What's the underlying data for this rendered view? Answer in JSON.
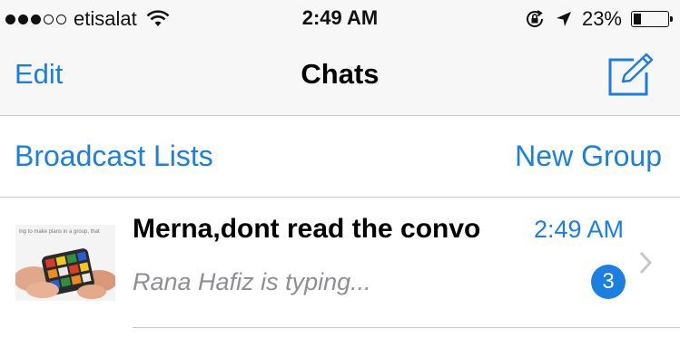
{
  "status_bar": {
    "signal_strength": "3 of 5",
    "carrier": "etisalat",
    "time": "2:49 AM",
    "battery_percent": "23%"
  },
  "nav": {
    "edit_label": "Edit",
    "title": "Chats",
    "compose_icon": "compose-icon"
  },
  "actions": {
    "broadcast_label": "Broadcast Lists",
    "new_group_label": "New Group"
  },
  "chats": [
    {
      "name": "Merna,dont read the convo",
      "time": "2:49 AM",
      "preview": "Rana Hafiz is typing...",
      "unread_count": "3",
      "avatar_caption": "ing to make plans in a group, that"
    }
  ],
  "colors": {
    "accent": "#1a7fe0",
    "bar_background": "#f7f7f7",
    "divider": "#c8c7cc",
    "preview_text": "#8e8e93"
  }
}
